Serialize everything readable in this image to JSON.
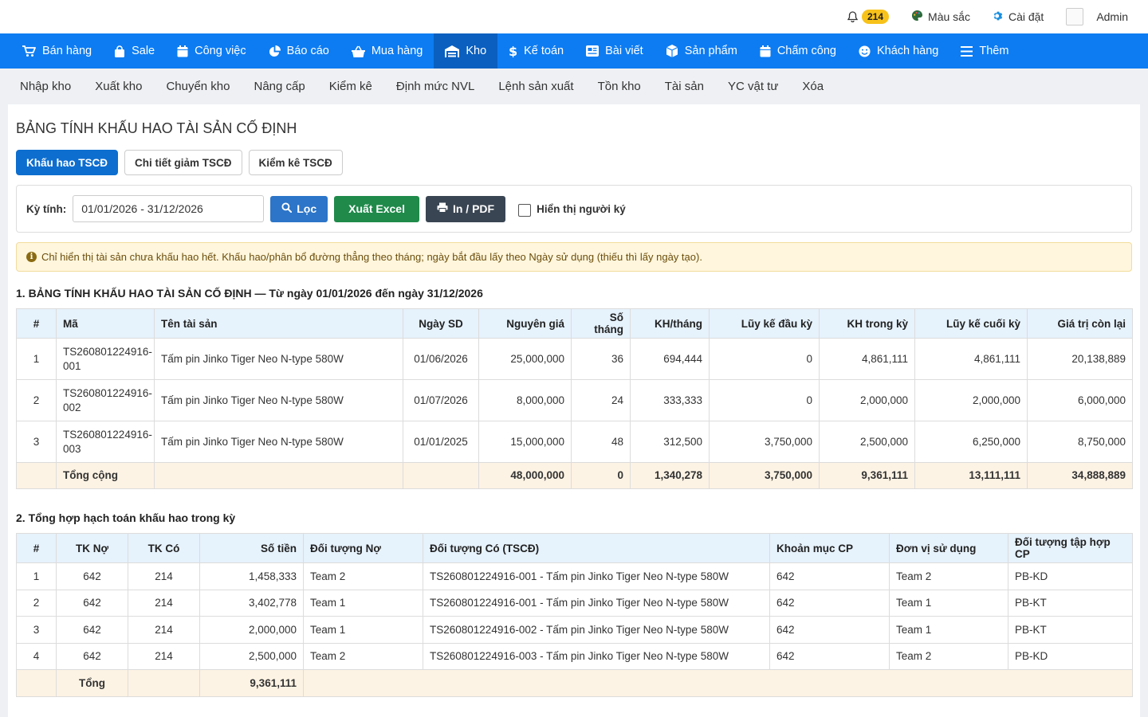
{
  "topbar": {
    "notif_count": "214",
    "color_label": "Màu sắc",
    "settings_label": "Cài đặt",
    "admin_label": "Admin"
  },
  "mainnav": [
    {
      "label": "Bán hàng",
      "icon": "cart-icon"
    },
    {
      "label": "Sale",
      "icon": "bag-icon"
    },
    {
      "label": "Công việc",
      "icon": "calendar-icon"
    },
    {
      "label": "Báo cáo",
      "icon": "pie-chart-icon"
    },
    {
      "label": "Mua hàng",
      "icon": "basket-icon"
    },
    {
      "label": "Kho",
      "icon": "warehouse-icon",
      "active": true
    },
    {
      "label": "Kế toán",
      "icon": "dollar-icon"
    },
    {
      "label": "Bài viết",
      "icon": "article-icon"
    },
    {
      "label": "Sản phẩm",
      "icon": "box-icon"
    },
    {
      "label": "Chấm công",
      "icon": "calendar-check-icon"
    },
    {
      "label": "Khách hàng",
      "icon": "smile-icon"
    },
    {
      "label": "Thêm",
      "icon": "menu-icon"
    }
  ],
  "subnav": [
    "Nhập kho",
    "Xuất kho",
    "Chuyển kho",
    "Nâng cấp",
    "Kiểm kê",
    "Định mức NVL",
    "Lệnh sản xuất",
    "Tồn kho",
    "Tài sản",
    "YC vật tư",
    "Xóa"
  ],
  "page": {
    "title": "BẢNG TÍNH KHẤU HAO TÀI SẢN CỐ ĐỊNH",
    "tabs": [
      "Khấu hao TSCĐ",
      "Chi tiết giảm TSCĐ",
      "Kiểm kê TSCĐ"
    ]
  },
  "filter": {
    "label": "Kỳ tính:",
    "range_value": "01/01/2026 - 31/12/2026",
    "filter_btn": "Lọc",
    "excel_btn": "Xuất Excel",
    "pdf_btn": "In / PDF",
    "signer_label": "Hiển thị người ký"
  },
  "alert": "Chỉ hiển thị tài sản chưa khấu hao hết. Khấu hao/phân bổ đường thẳng theo tháng; ngày bắt đầu lấy theo Ngày sử dụng (thiếu thì lấy ngày tạo).",
  "section1": {
    "title": "1. BẢNG TÍNH KHẤU HAO TÀI SẢN CỐ ĐỊNH — Từ ngày 01/01/2026 đến ngày 31/12/2026",
    "headers": [
      "#",
      "Mã",
      "Tên tài sản",
      "Ngày SD",
      "Nguyên giá",
      "Số tháng",
      "KH/tháng",
      "Lũy kế đầu kỳ",
      "KH trong kỳ",
      "Lũy kế cuối kỳ",
      "Giá trị còn lại"
    ],
    "rows": [
      [
        "1",
        "TS260801224916-001",
        "Tấm pin Jinko Tiger Neo N-type 580W",
        "01/06/2026",
        "25,000,000",
        "36",
        "694,444",
        "0",
        "4,861,111",
        "4,861,111",
        "20,138,889"
      ],
      [
        "2",
        "TS260801224916-002",
        "Tấm pin Jinko Tiger Neo N-type 580W",
        "01/07/2026",
        "8,000,000",
        "24",
        "333,333",
        "0",
        "2,000,000",
        "2,000,000",
        "6,000,000"
      ],
      [
        "3",
        "TS260801224916-003",
        "Tấm pin Jinko Tiger Neo N-type 580W",
        "01/01/2025",
        "15,000,000",
        "48",
        "312,500",
        "3,750,000",
        "2,500,000",
        "6,250,000",
        "8,750,000"
      ]
    ],
    "total": {
      "label": "Tổng cộng",
      "nguyen_gia": "48,000,000",
      "so_thang": "0",
      "kh_thang": "1,340,278",
      "luy_ke_dau": "3,750,000",
      "kh_trong_ky": "9,361,111",
      "luy_ke_cuoi": "13,111,111",
      "con_lai": "34,888,889"
    }
  },
  "section2": {
    "title": "2. Tổng hợp hạch toán khấu hao trong kỳ",
    "headers": [
      "#",
      "TK Nợ",
      "TK Có",
      "Số tiền",
      "Đối tượng Nợ",
      "Đối tượng Có (TSCĐ)",
      "Khoản mục CP",
      "Đơn vị sử dụng",
      "Đối tượng tập hợp CP"
    ],
    "rows": [
      [
        "1",
        "642",
        "214",
        "1,458,333",
        "Team 2",
        "TS260801224916-001 - Tấm pin Jinko Tiger Neo N-type 580W",
        "642",
        "Team 2",
        "PB-KD"
      ],
      [
        "2",
        "642",
        "214",
        "3,402,778",
        "Team 1",
        "TS260801224916-001 - Tấm pin Jinko Tiger Neo N-type 580W",
        "642",
        "Team 1",
        "PB-KT"
      ],
      [
        "3",
        "642",
        "214",
        "2,000,000",
        "Team 1",
        "TS260801224916-002 - Tấm pin Jinko Tiger Neo N-type 580W",
        "642",
        "Team 1",
        "PB-KT"
      ],
      [
        "4",
        "642",
        "214",
        "2,500,000",
        "Team 2",
        "TS260801224916-003 - Tấm pin Jinko Tiger Neo N-type 580W",
        "642",
        "Team 2",
        "PB-KD"
      ]
    ],
    "total": {
      "label": "Tổng",
      "amount": "9,361,111"
    }
  }
}
